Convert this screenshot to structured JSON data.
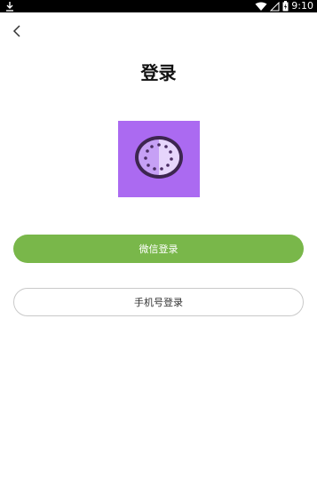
{
  "status_bar": {
    "time": "9:10",
    "icons": [
      "download-icon",
      "wifi-icon",
      "signal-icon",
      "battery-icon"
    ]
  },
  "header": {
    "back_icon": "chevron-left-icon",
    "title": "登录"
  },
  "logo": {
    "icon": "dial-logo-icon",
    "background_color": "#ab6af1"
  },
  "buttons": {
    "wechat_login": "微信登录",
    "phone_login": "手机号登录"
  },
  "colors": {
    "accent_green": "#79b74a",
    "outline_gray": "#c9c9c9"
  }
}
